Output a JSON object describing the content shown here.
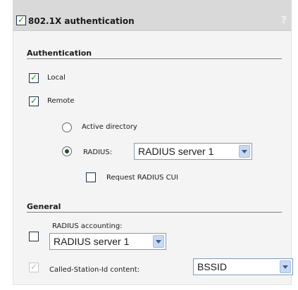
{
  "header": {
    "title": "802.1X authentication",
    "enabled": true,
    "help_icon_text": "?"
  },
  "authentication": {
    "section_label": "Authentication",
    "local": {
      "label": "Local",
      "checked": true
    },
    "remote": {
      "label": "Remote",
      "checked": true
    },
    "active_directory": {
      "label": "Active directory",
      "selected": false
    },
    "radius": {
      "label": "RADIUS:",
      "selected": true,
      "server": "RADIUS server 1"
    },
    "request_cui": {
      "label": "Request RADIUS CUI",
      "checked": false
    }
  },
  "general": {
    "section_label": "General",
    "radius_accounting": {
      "label": "RADIUS accounting:",
      "checked": false,
      "server": "RADIUS server 1"
    },
    "called_station_id": {
      "label": "Called-Station-Id content:",
      "checked": true,
      "disabled": true,
      "value": "BSSID"
    }
  }
}
